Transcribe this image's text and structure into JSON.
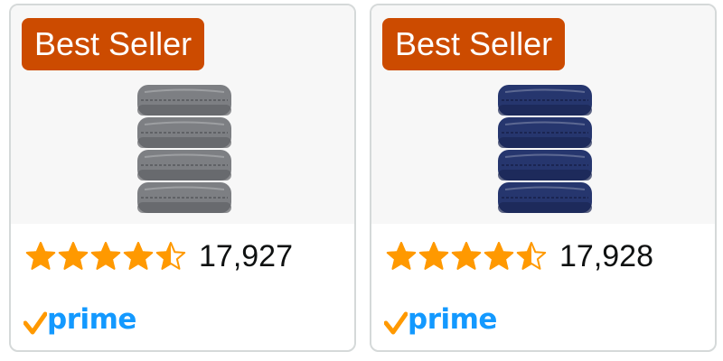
{
  "products": [
    {
      "badge_label": "Best Seller",
      "image_alt": "Gray towel stack",
      "towel_color": "#7d7f83",
      "towel_shadow": "#5f6165",
      "rating": 4.5,
      "reviews_count": "17,927",
      "prime_label": "prime"
    },
    {
      "badge_label": "Best Seller",
      "image_alt": "Navy towel stack",
      "towel_color": "#26366e",
      "towel_shadow": "#1a2552",
      "rating": 4.5,
      "reviews_count": "17,928",
      "prime_label": "prime"
    }
  ],
  "colors": {
    "badge_bg": "#cc4b00",
    "star_fill": "#ff9900",
    "star_outline": "#ff9900",
    "prime_blue": "#1399ff",
    "prime_check": "#ff9900",
    "card_border": "#d5d9d9",
    "image_bg": "#f7f7f7"
  },
  "icons": {
    "star_full": "star-full-icon",
    "star_half": "star-half-icon",
    "star_empty": "star-empty-icon",
    "prime_check": "prime-check-icon"
  }
}
